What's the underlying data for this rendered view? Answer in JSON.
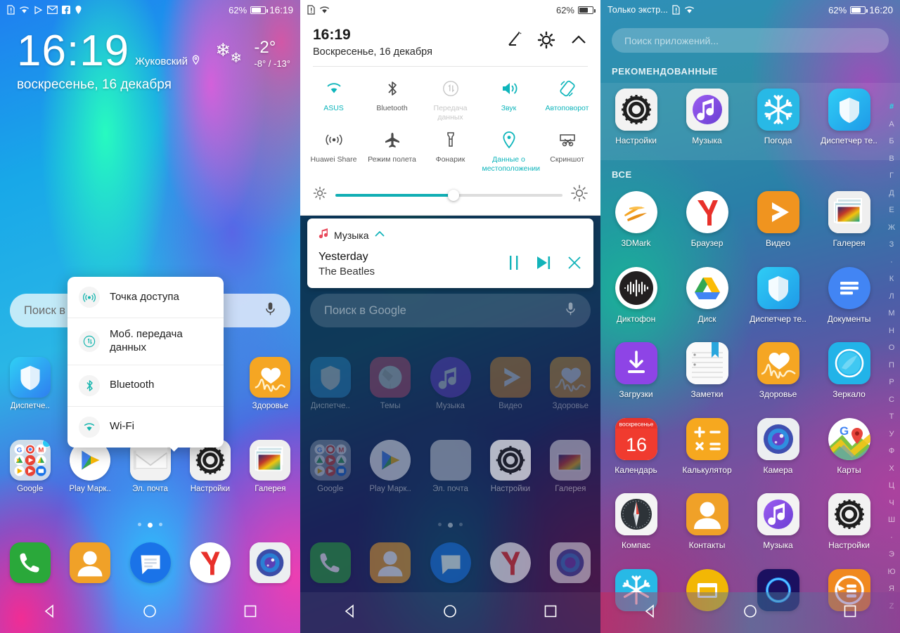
{
  "panel1": {
    "statusbar": {
      "icons": [
        "sim-alert-icon",
        "wifi-icon",
        "play-icon",
        "gmail-icon",
        "facebook-icon",
        "location-icon"
      ],
      "battery_percent": "62%",
      "time": "16:19"
    },
    "clock": {
      "time": "16:19",
      "city": "Жуковский",
      "date": "воскресенье, 16 декабря",
      "weather_temp": "-2°",
      "weather_range": "-8° / -13°",
      "weather_icon": "snowflake-icon"
    },
    "search": {
      "placeholder": "Поиск в Google",
      "mic_icon": "microphone-icon"
    },
    "popup": {
      "items": [
        {
          "label": "Точка доступа",
          "icon": "hotspot-icon"
        },
        {
          "label": "Моб. передача данных",
          "icon": "mobile-data-icon"
        },
        {
          "label": "Bluetooth",
          "icon": "bluetooth-icon"
        },
        {
          "label": "Wi-Fi",
          "icon": "wifi-icon"
        }
      ]
    },
    "row_apps": [
      {
        "label": "Диспетче..",
        "icon": "shield-icon"
      },
      {
        "label": "",
        "icon": "themes-icon"
      },
      {
        "label": "",
        "icon": "music-icon"
      },
      {
        "label": "",
        "icon": "video-icon"
      },
      {
        "label": "Здоровье",
        "icon": "health-icon"
      }
    ],
    "row2_apps": [
      {
        "label": "Google",
        "icon": "google-folder-icon",
        "badge": true
      },
      {
        "label": "Play Марк..",
        "icon": "play-store-icon",
        "badge": true
      },
      {
        "label": "Эл. почта",
        "icon": "email-icon",
        "badge": false
      },
      {
        "label": "Настройки",
        "icon": "settings-icon",
        "badge": false
      },
      {
        "label": "Галерея",
        "icon": "gallery-icon",
        "badge": false
      }
    ],
    "dock": [
      {
        "label": "",
        "icon": "phone-icon"
      },
      {
        "label": "",
        "icon": "contacts-icon"
      },
      {
        "label": "",
        "icon": "messages-icon"
      },
      {
        "label": "",
        "icon": "yandex-icon"
      },
      {
        "label": "",
        "icon": "camera-icon"
      }
    ],
    "page_dots": {
      "count": 3,
      "active": 1
    },
    "navbar": [
      "back-icon",
      "home-icon",
      "recents-icon"
    ]
  },
  "panel2": {
    "statusbar": {
      "icons": [
        "sim-alert-icon",
        "wifi-icon"
      ],
      "battery_percent": "62%"
    },
    "shade": {
      "time": "16:19",
      "date": "Воскресенье, 16 декабря",
      "actions": [
        "edit-icon",
        "gear-icon",
        "collapse-chevron-icon"
      ],
      "toggles_row1": [
        {
          "label": "ASUS",
          "icon": "wifi-icon",
          "state": "on"
        },
        {
          "label": "Bluetooth",
          "icon": "bluetooth-icon",
          "state": "off"
        },
        {
          "label": "Передача данных",
          "icon": "data-transfer-icon",
          "state": "disabled"
        },
        {
          "label": "Звук",
          "icon": "sound-icon",
          "state": "on"
        },
        {
          "label": "Автоповорот",
          "icon": "auto-rotate-icon",
          "state": "on"
        }
      ],
      "toggles_row2": [
        {
          "label": "Huawei Share",
          "icon": "huawei-share-icon",
          "state": "off"
        },
        {
          "label": "Режим полета",
          "icon": "airplane-icon",
          "state": "off"
        },
        {
          "label": "Фонарик",
          "icon": "flashlight-icon",
          "state": "off"
        },
        {
          "label": "Данные о местоположении",
          "icon": "location-pin-icon",
          "state": "on"
        },
        {
          "label": "Скриншот",
          "icon": "screenshot-icon",
          "state": "off"
        }
      ],
      "brightness": {
        "low_icon": "brightness-low-icon",
        "high_icon": "brightness-high-icon",
        "value_percent": 52
      }
    },
    "music": {
      "app_name": "Музыка",
      "app_icon": "music-note-icon",
      "expand_icon": "chevron-up-icon",
      "title": "Yesterday",
      "artist": "The Beatles",
      "controls": [
        "pause-icon",
        "next-track-icon",
        "close-icon"
      ]
    },
    "search": {
      "placeholder": "Поиск в Google",
      "mic_icon": "microphone-icon"
    },
    "row_apps": [
      {
        "label": "Диспетче..",
        "icon": "shield-icon"
      },
      {
        "label": "Темы",
        "icon": "themes-icon"
      },
      {
        "label": "Музыка",
        "icon": "music-icon"
      },
      {
        "label": "Видео",
        "icon": "video-icon"
      },
      {
        "label": "Здоровье",
        "icon": "health-icon"
      }
    ],
    "row2_apps": [
      {
        "label": "Google",
        "icon": "google-folder-icon"
      },
      {
        "label": "Play Марк..",
        "icon": "play-store-icon"
      },
      {
        "label": "Эл. почта",
        "icon": "email-icon"
      },
      {
        "label": "Настройки",
        "icon": "settings-icon"
      },
      {
        "label": "Галерея",
        "icon": "gallery-icon"
      }
    ],
    "dock": [
      {
        "label": "",
        "icon": "phone-icon"
      },
      {
        "label": "",
        "icon": "contacts-icon"
      },
      {
        "label": "",
        "icon": "messages-icon"
      },
      {
        "label": "",
        "icon": "yandex-icon"
      },
      {
        "label": "",
        "icon": "camera-icon"
      }
    ],
    "page_dots": {
      "count": 3,
      "active": 1
    },
    "navbar": [
      "back-icon",
      "home-icon",
      "recents-icon"
    ]
  },
  "panel3": {
    "statusbar": {
      "carrier": "Только экстр...",
      "icons": [
        "sim-alert-icon",
        "wifi-icon"
      ],
      "battery_percent": "62%",
      "time": "16:20"
    },
    "search": {
      "placeholder": "Поиск приложений..."
    },
    "section_recommended": "РЕКОМЕНДОВАННЫЕ",
    "section_all": "ВСЕ",
    "recommended": [
      {
        "label": "Настройки",
        "icon": "settings-icon"
      },
      {
        "label": "Музыка",
        "icon": "music-icon"
      },
      {
        "label": "Погода",
        "icon": "weather-icon"
      },
      {
        "label": "Диспетчер те..",
        "icon": "shield-icon"
      }
    ],
    "all_apps": [
      {
        "label": "3DMark",
        "icon": "3dmark-icon"
      },
      {
        "label": "Браузер",
        "icon": "yandex-icon"
      },
      {
        "label": "Видео",
        "icon": "video-icon"
      },
      {
        "label": "Галерея",
        "icon": "gallery-icon"
      },
      {
        "label": "Диктофон",
        "icon": "recorder-icon"
      },
      {
        "label": "Диск",
        "icon": "drive-icon"
      },
      {
        "label": "Диспетчер те..",
        "icon": "shield-icon"
      },
      {
        "label": "Документы",
        "icon": "docs-icon"
      },
      {
        "label": "Загрузки",
        "icon": "downloads-icon"
      },
      {
        "label": "Заметки",
        "icon": "notes-icon"
      },
      {
        "label": "Здоровье",
        "icon": "health-icon"
      },
      {
        "label": "Зеркало",
        "icon": "mirror-icon"
      },
      {
        "label": "Календарь",
        "icon": "calendar-icon",
        "calendar_weekday": "воскресенье",
        "calendar_day": "16"
      },
      {
        "label": "Калькулятор",
        "icon": "calculator-icon"
      },
      {
        "label": "Камера",
        "icon": "camera-icon"
      },
      {
        "label": "Карты",
        "icon": "maps-icon"
      },
      {
        "label": "Компас",
        "icon": "compass-icon"
      },
      {
        "label": "Контакты",
        "icon": "contacts-icon"
      },
      {
        "label": "Музыка",
        "icon": "music-icon"
      },
      {
        "label": "Настройки",
        "icon": "settings-icon"
      },
      {
        "label": "",
        "icon": "weather-icon"
      },
      {
        "label": "",
        "icon": "notepad-icon"
      },
      {
        "label": "",
        "icon": "ring-icon"
      },
      {
        "label": "",
        "icon": "backup-icon"
      }
    ],
    "alphabet_index": [
      "#",
      "А",
      "Б",
      "В",
      "Г",
      "Д",
      "Е",
      "Ж",
      "З",
      "·",
      "К",
      "Л",
      "М",
      "Н",
      "О",
      "П",
      "Р",
      "С",
      "Т",
      "У",
      "Ф",
      "Х",
      "Ц",
      "Ч",
      "Ш",
      "·",
      "Э",
      "Ю",
      "Я",
      "Z"
    ],
    "alphabet_highlight": "#",
    "navbar": [
      "back-icon",
      "home-icon",
      "recents-icon"
    ]
  },
  "colors": {
    "accent_teal": "#11aeb4",
    "toggle_on": "#0eb5bb",
    "toggle_off": "#5a5a5a",
    "toggle_disabled": "#c7c7c7",
    "alphabet_highlight": "#23e0e8"
  }
}
